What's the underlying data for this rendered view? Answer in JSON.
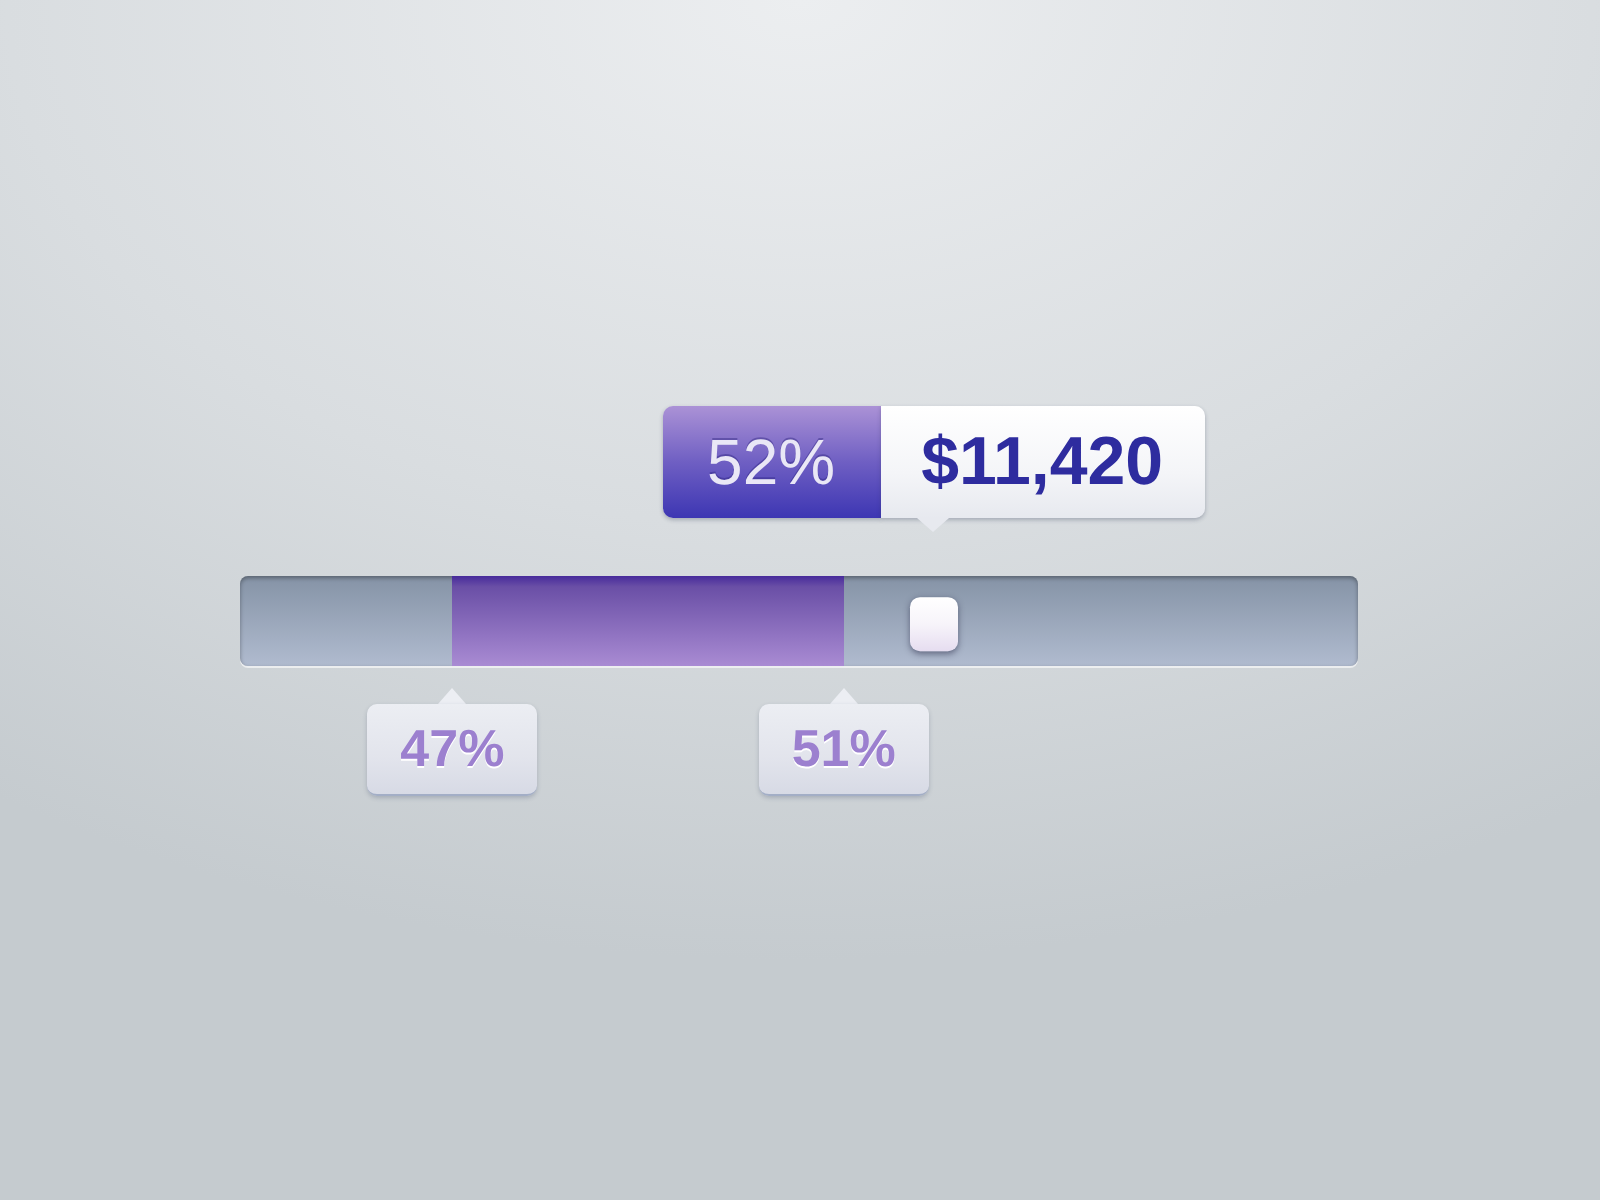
{
  "tooltip": {
    "percent": "52%",
    "amount": "$11,420"
  },
  "slider": {
    "range": {
      "level": 0.35
    },
    "thumb": {
      "level": 0.62
    },
    "markers": [
      {
        "label": "47%",
        "level": 0.19
      },
      {
        "label": "51%",
        "level": 0.54
      }
    ]
  }
}
